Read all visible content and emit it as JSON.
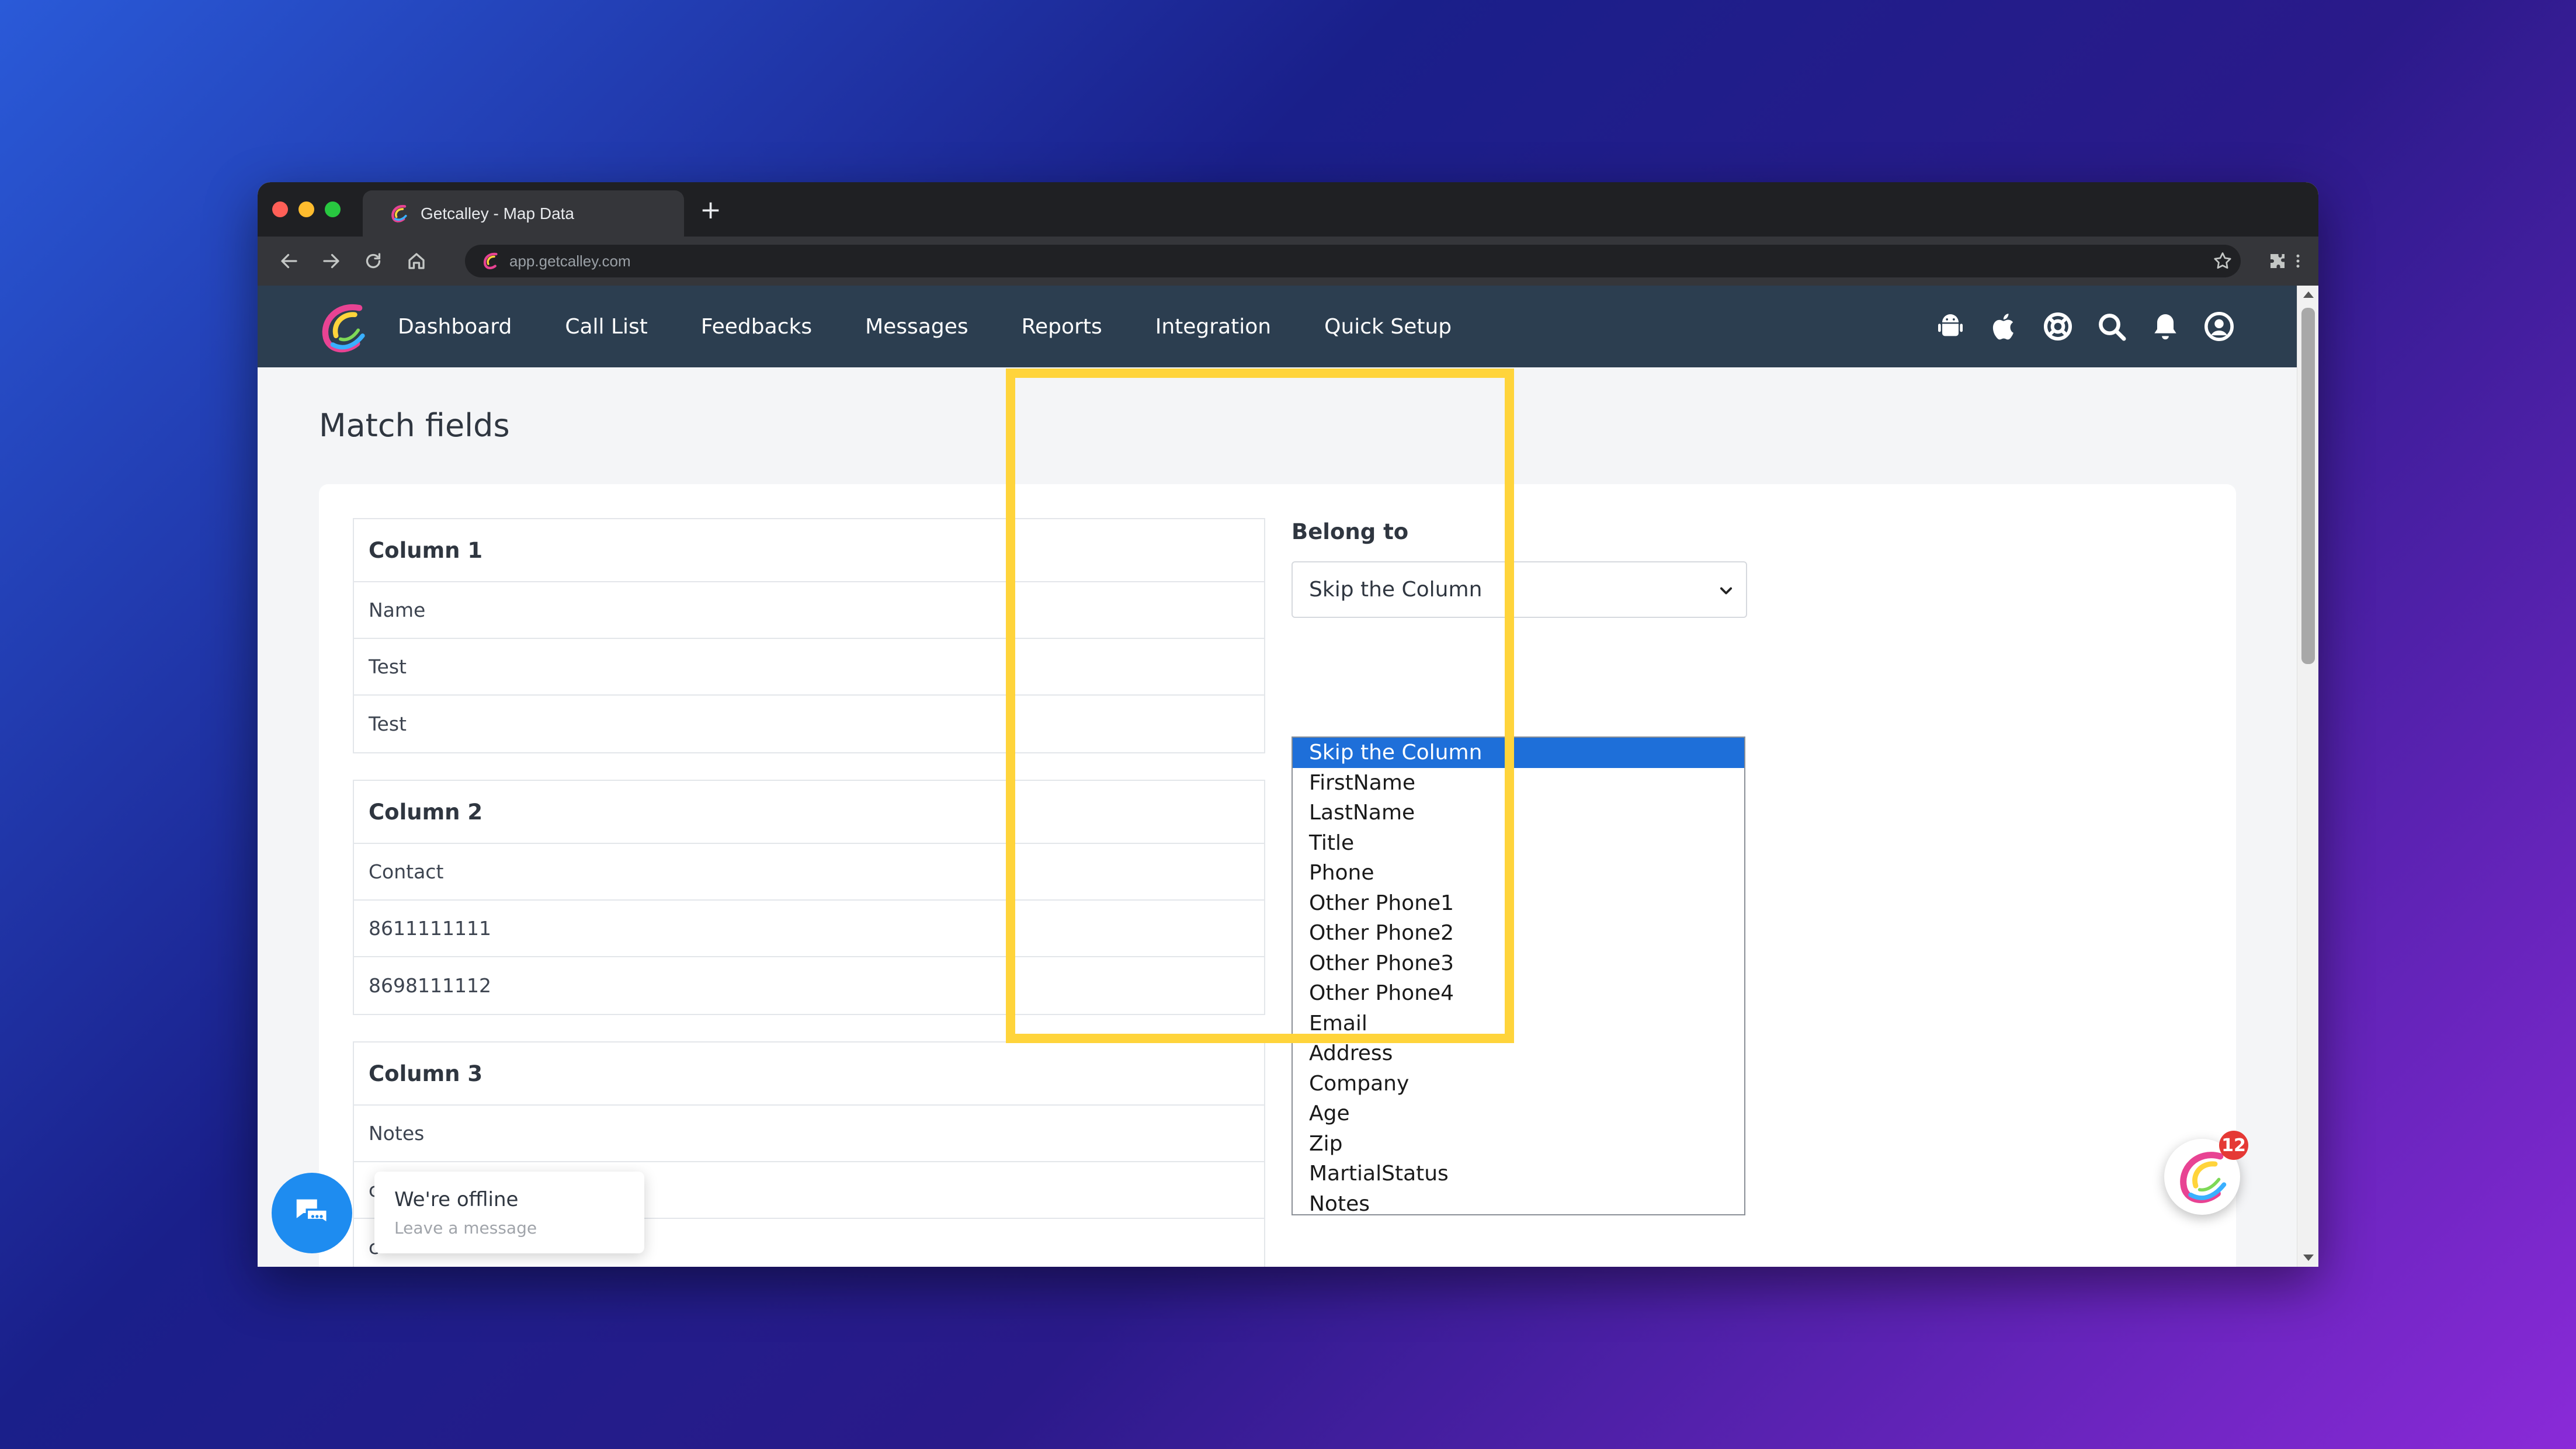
{
  "browser": {
    "tab_title": "Getcalley - Map Data",
    "new_tab_label": "+",
    "url": "app.getcalley.com"
  },
  "nav": {
    "items": [
      "Dashboard",
      "Call List",
      "Feedbacks",
      "Messages",
      "Reports",
      "Integration",
      "Quick Setup"
    ],
    "icons": [
      "android-icon",
      "apple-icon",
      "support-icon",
      "search-icon",
      "bell-icon",
      "user-icon"
    ]
  },
  "page": {
    "title": "Match fields"
  },
  "columns": [
    {
      "header": "Column 1",
      "cells": [
        "Name",
        "Test",
        "Test"
      ]
    },
    {
      "header": "Column 2",
      "cells": [
        "Contact",
        "8611111111",
        "8698111112"
      ]
    },
    {
      "header": "Column 3",
      "cells": [
        "Notes",
        "c",
        "c"
      ]
    }
  ],
  "belong": {
    "label": "Belong to",
    "selected": "Skip the Column",
    "options": [
      "Skip the Column",
      "FirstName",
      "LastName",
      "Title",
      "Phone",
      "Other Phone1",
      "Other Phone2",
      "Other Phone3",
      "Other Phone4",
      "Email",
      "Address",
      "Company",
      "Age",
      "Zip",
      "MartialStatus",
      "Notes"
    ]
  },
  "chat": {
    "title": "We're offline",
    "subtitle": "Leave a message"
  },
  "float_badge": {
    "count": "12"
  },
  "colors": {
    "navbar": "#2c3e50",
    "highlight": "#ffd43b",
    "selected_option": "#1e6fd9",
    "chat_blue": "#1e8cf0",
    "badge_red": "#e53935"
  }
}
